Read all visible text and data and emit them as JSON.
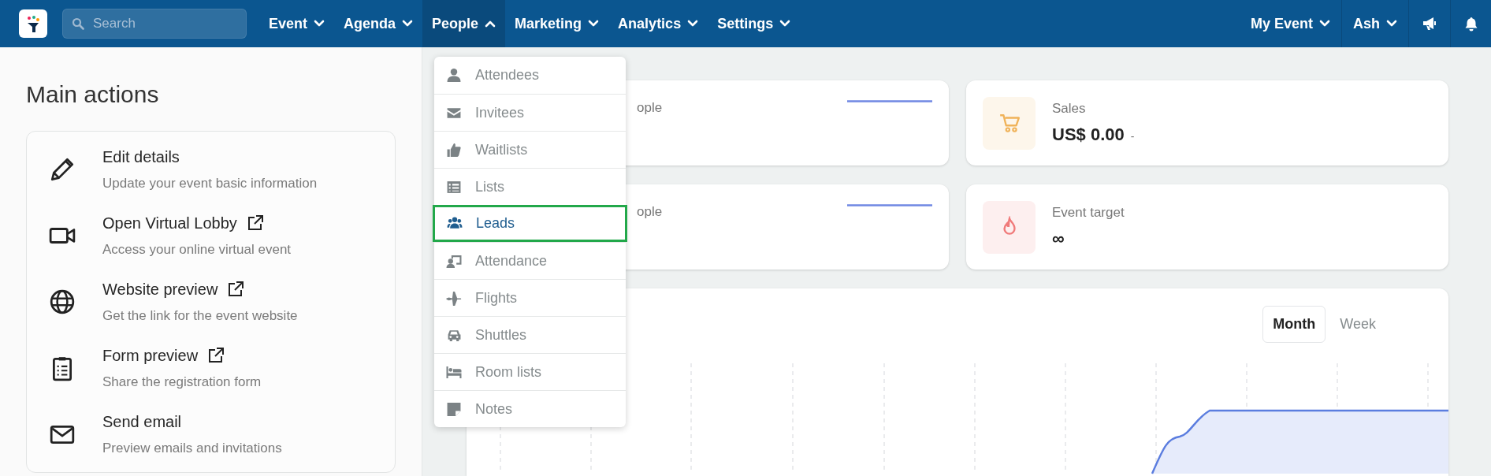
{
  "navbar": {
    "search": {
      "placeholder": "Search"
    },
    "menus": [
      {
        "label": "Event",
        "expanded": false
      },
      {
        "label": "Agenda",
        "expanded": false
      },
      {
        "label": "People",
        "expanded": true
      },
      {
        "label": "Marketing",
        "expanded": false
      },
      {
        "label": "Analytics",
        "expanded": false
      },
      {
        "label": "Settings",
        "expanded": false
      }
    ],
    "right_menus": [
      {
        "label": "My Event",
        "expanded": false
      },
      {
        "label": "Ash",
        "expanded": false
      }
    ]
  },
  "people_menu": [
    {
      "label": "Attendees",
      "selected": false
    },
    {
      "label": "Invitees",
      "selected": false
    },
    {
      "label": "Waitlists",
      "selected": false
    },
    {
      "label": "Lists",
      "selected": false
    },
    {
      "label": "Leads",
      "selected": true
    },
    {
      "label": "Attendance",
      "selected": false
    },
    {
      "label": "Flights",
      "selected": false
    },
    {
      "label": "Shuttles",
      "selected": false
    },
    {
      "label": "Room lists",
      "selected": false
    },
    {
      "label": "Notes",
      "selected": false
    }
  ],
  "main_actions": {
    "title": "Main actions",
    "items": [
      {
        "title": "Edit details",
        "description": "Update your event basic information",
        "external": false
      },
      {
        "title": "Open Virtual Lobby",
        "description": "Access your online virtual event",
        "external": true
      },
      {
        "title": "Website preview",
        "description": "Get the link for the event website",
        "external": true
      },
      {
        "title": "Form preview",
        "description": "Share the registration form",
        "external": true
      },
      {
        "title": "Send email",
        "description": "Preview emails and invitations",
        "external": false
      }
    ]
  },
  "stats": [
    {
      "kind": "sparkline",
      "label": "ople"
    },
    {
      "kind": "icon",
      "label": "Sales",
      "value": "US$ 0.00",
      "suffix": "-",
      "color": "#f0b35a"
    },
    {
      "kind": "sparkline",
      "label": "ople"
    },
    {
      "kind": "icon",
      "label": "Event target",
      "value": "∞",
      "color": "#f07a7a"
    }
  ],
  "chart_toggle": [
    {
      "label": "Month",
      "selected": true
    },
    {
      "label": "Week",
      "selected": false
    }
  ]
}
